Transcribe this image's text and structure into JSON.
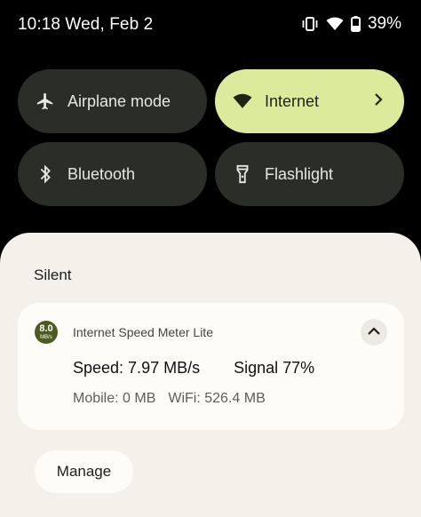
{
  "status_bar": {
    "time_date": "10:18 Wed, Feb 2",
    "battery": "39%",
    "icons": [
      "vibrate-icon",
      "wifi-icon",
      "battery-icon"
    ]
  },
  "quick_settings": {
    "tiles": [
      {
        "label": "Airplane mode",
        "icon": "airplane-icon",
        "active": false
      },
      {
        "label": "Internet",
        "icon": "wifi-icon",
        "active": true
      },
      {
        "label": "Bluetooth",
        "icon": "bluetooth-icon",
        "active": false
      },
      {
        "label": "Flashlight",
        "icon": "flashlight-icon",
        "active": false
      }
    ],
    "active_color": "#dceb9b",
    "inactive_color": "#2b2d29"
  },
  "notifications": {
    "section_title": "Silent",
    "card": {
      "app_icon_value": "8.0",
      "app_icon_unit": "MB/s",
      "app_name": "Internet Speed Meter Lite",
      "speed": "Speed: 7.97 MB/s",
      "signal": "Signal 77%",
      "mobile": "Mobile: 0 MB",
      "wifi": "WiFi: 526.4 MB"
    },
    "manage_label": "Manage"
  }
}
